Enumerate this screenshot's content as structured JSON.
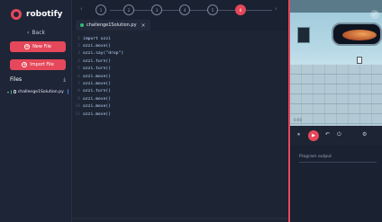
{
  "app": {
    "brand": "robotify"
  },
  "sidebar": {
    "back_label": "Back",
    "new_file_label": "New File",
    "import_file_label": "Import File",
    "files_heading": "Files",
    "file_item": "challenge1Solution.py"
  },
  "stepper": {
    "steps": [
      "1",
      "2",
      "3",
      "4",
      "5",
      "6"
    ],
    "active_step": "6"
  },
  "editor": {
    "tab_label": "challenge1Solution.py",
    "code_lines": [
      "import ozzi",
      "ozzi.move()",
      "ozzi.say(\"drop\")",
      "ozzi.turn()",
      "ozzi.turn()",
      "ozzi.move()",
      "ozzi.move()",
      "ozzi.turn()",
      "ozzi.move()",
      "ozzi.move()",
      "ozzi.move()"
    ]
  },
  "simulator": {
    "time_text": "0:00"
  },
  "output": {
    "placeholder": "Program output"
  },
  "colors": {
    "accent": "#e5485a",
    "background": "#1b2233",
    "success": "#2fbf71",
    "info": "#3b82f6"
  },
  "icons": [
    "robotify-logo-icon",
    "back-arrow-icon",
    "plus-circle-icon",
    "upload-icon",
    "chevron-down-icon",
    "check-circle-icon",
    "folder-icon",
    "python-file-icon",
    "close-icon",
    "expand-icon",
    "pause-icon",
    "run-icon",
    "undo-icon",
    "power-icon",
    "settings-icon"
  ]
}
